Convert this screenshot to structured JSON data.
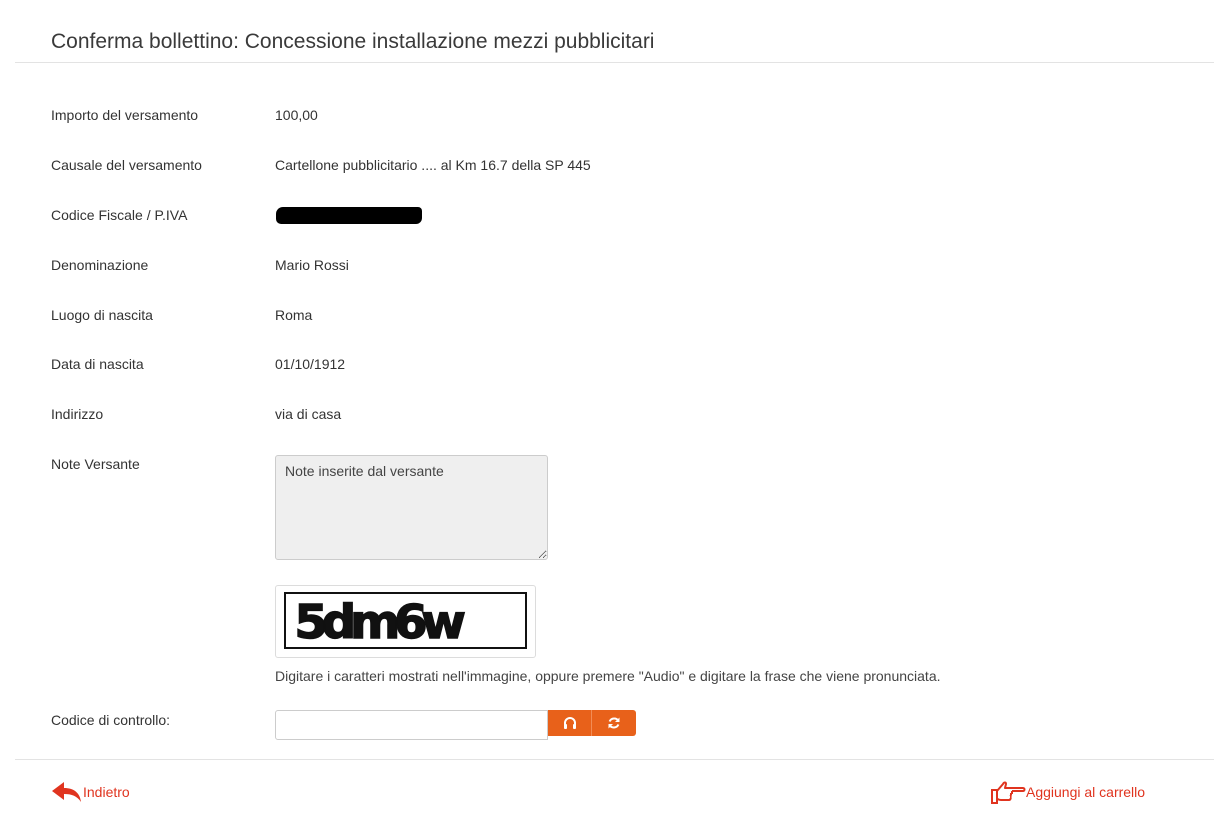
{
  "page": {
    "title": "Conferma bollettino: Concessione installazione mezzi pubblicitari"
  },
  "fields": {
    "importo": {
      "label": "Importo del versamento",
      "value": "100,00"
    },
    "causale": {
      "label": "Causale del versamento",
      "value": "Cartellone pubblicitario .... al Km 16.7 della SP 445"
    },
    "codice_fiscale": {
      "label": "Codice Fiscale / P.IVA"
    },
    "denominazione": {
      "label": "Denominazione",
      "value": "Mario Rossi"
    },
    "luogo_nascita": {
      "label": "Luogo di nascita",
      "value": "Roma"
    },
    "data_nascita": {
      "label": "Data di nascita",
      "value": "01/10/1912"
    },
    "indirizzo": {
      "label": "Indirizzo",
      "value": "via di casa"
    },
    "note": {
      "label": "Note Versante",
      "value": "Note inserite dal versante"
    }
  },
  "captcha": {
    "image_text": "5dm6w",
    "help": "Digitare i caratteri mostrati nell'immagine, oppure premere \"Audio\" e digitare la frase che viene pronunciata.",
    "code_label": "Codice di controllo:",
    "code_value": ""
  },
  "buttons": {
    "audio_icon": "headphones-icon",
    "refresh_icon": "refresh-icon",
    "accent_color": "#e8611a"
  },
  "footer": {
    "back_label": "Indietro",
    "back_icon": "reply-arrow-icon",
    "cart_label": "Aggiungi al carrello",
    "cart_icon": "hand-pointing-icon",
    "link_color": "#e0341f"
  }
}
